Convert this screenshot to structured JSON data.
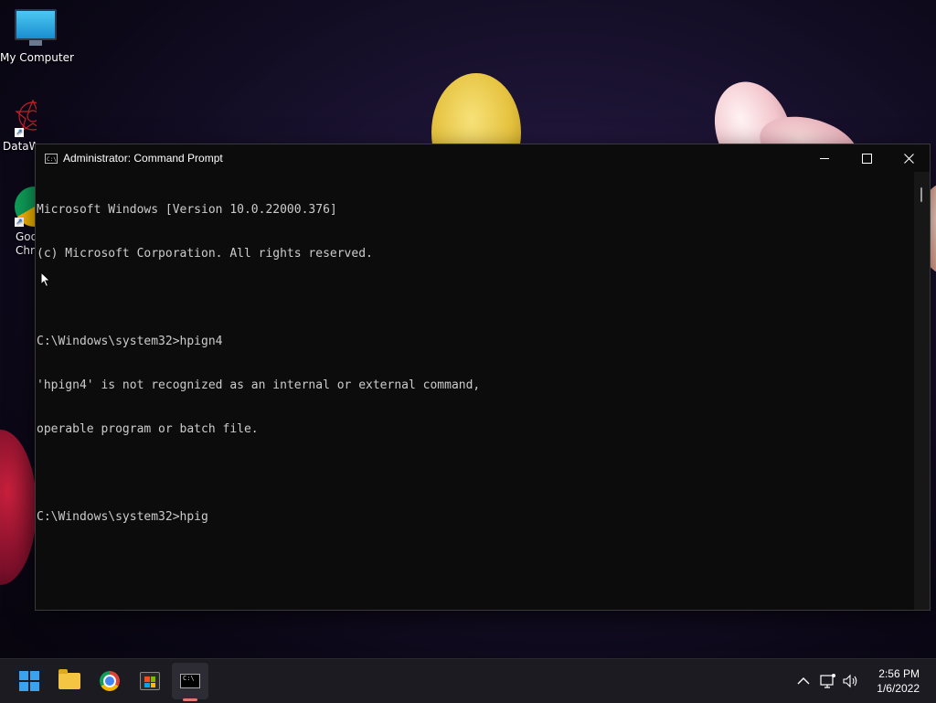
{
  "desktop": {
    "icons": [
      {
        "label": "My Computer",
        "icon": "computer-icon"
      },
      {
        "label": "DataW",
        "icon": "datawrapper-icon"
      },
      {
        "label": "Goo\nChro",
        "icon": "chrome-icon"
      }
    ]
  },
  "window": {
    "title": "Administrator: Command Prompt",
    "icon": "cmd-icon",
    "console_lines": [
      "Microsoft Windows [Version 10.0.22000.376]",
      "(c) Microsoft Corporation. All rights reserved.",
      "",
      "C:\\Windows\\system32>hpign4",
      "'hpign4' is not recognized as an internal or external command,",
      "operable program or batch file.",
      "",
      "C:\\Windows\\system32>hpig"
    ],
    "controls": {
      "minimize": "minimize-icon",
      "maximize": "maximize-icon",
      "close": "close-icon"
    }
  },
  "taskbar": {
    "apps": [
      {
        "name": "start",
        "icon": "windows-start-icon"
      },
      {
        "name": "file-explorer",
        "icon": "folder-icon"
      },
      {
        "name": "chrome",
        "icon": "chrome-icon"
      },
      {
        "name": "microsoft-store",
        "icon": "store-icon"
      },
      {
        "name": "terminal",
        "icon": "terminal-icon",
        "active": true
      }
    ],
    "tray": {
      "chevron": "chevron-up-icon",
      "network": "network-icon",
      "volume": "volume-icon",
      "time": "2:56 PM",
      "date": "1/6/2022"
    }
  }
}
